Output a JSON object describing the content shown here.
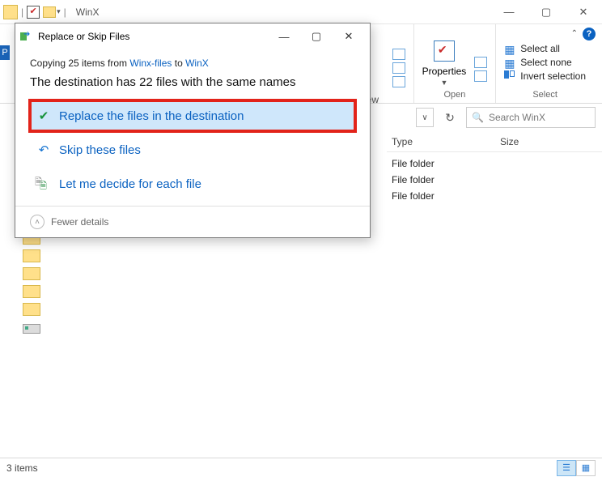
{
  "window": {
    "title": "WinX",
    "status_text": "3 items"
  },
  "ribbon": {
    "groups": {
      "open": {
        "label": "Open",
        "properties": "Properties"
      },
      "select": {
        "label": "Select",
        "select_all": "Select all",
        "select_none": "Select none",
        "invert": "Invert selection"
      }
    },
    "hidden_tab": "iew"
  },
  "navbar": {
    "search_placeholder": "Search WinX"
  },
  "columns": {
    "type": "Type",
    "size": "Size"
  },
  "rows": [
    {
      "type": "File folder"
    },
    {
      "type": "File folder"
    },
    {
      "type": "File folder"
    }
  ],
  "dialog": {
    "title": "Replace or Skip Files",
    "copy_prefix": "Copying 25 items from ",
    "copy_src": "Winx-files",
    "copy_mid": " to ",
    "copy_dst": "WinX",
    "heading": "The destination has 22 files with the same names",
    "opt_replace": "Replace the files in the destination",
    "opt_skip": "Skip these files",
    "opt_decide": "Let me decide for each file",
    "fewer": "Fewer details"
  },
  "p_label": "P"
}
